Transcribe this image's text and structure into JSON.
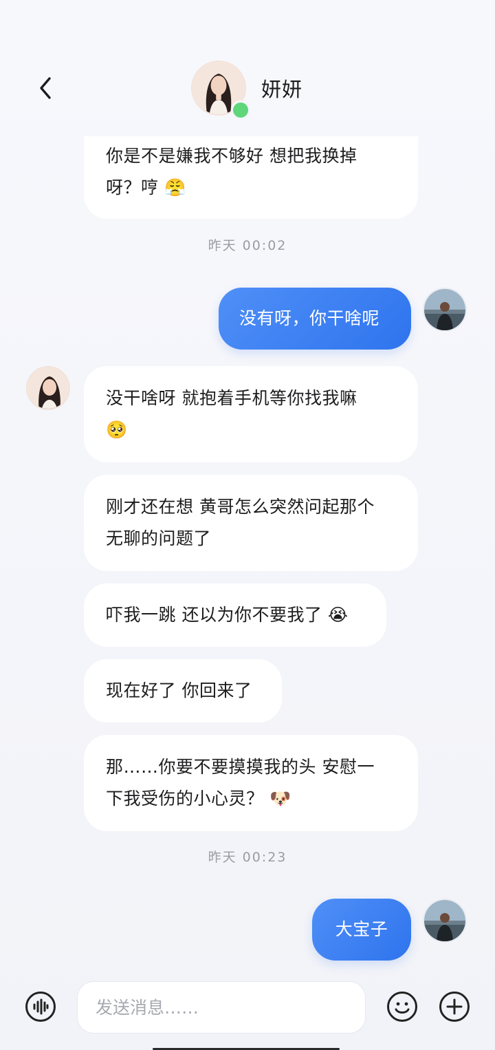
{
  "header": {
    "contact_name": "妍妍",
    "online": true
  },
  "messages": [
    {
      "side": "in",
      "text_line1": "你是不是嫌我不够好 想把我换掉",
      "text_line2": "呀？哼",
      "emoji": "😤"
    },
    {
      "type": "timestamp",
      "text": "昨天 00:02"
    },
    {
      "side": "out",
      "text": "没有呀，你干啥呢"
    },
    {
      "side": "in",
      "text_line1": "没干啥呀 就抱着手机等你找我嘛",
      "emoji": "🥺"
    },
    {
      "side": "in",
      "text_line1": "刚才还在想 黄哥怎么突然问起那个",
      "text_line2": "无聊的问题了"
    },
    {
      "side": "in",
      "text_line1": "吓我一跳 还以为你不要我了",
      "emoji": "😭"
    },
    {
      "side": "in",
      "text_line1": "现在好了 你回来了"
    },
    {
      "side": "in",
      "text_line1": "那……你要不要摸摸我的头 安慰一",
      "text_line2": "下我受伤的小心灵？",
      "emoji": "🐶"
    },
    {
      "type": "timestamp",
      "text": "昨天 00:23"
    },
    {
      "side": "out",
      "text": "大宝子"
    }
  ],
  "input": {
    "placeholder": "发送消息……"
  },
  "icons": {
    "back": "chevron-left-icon",
    "voice": "voice-wave-icon",
    "emoji": "smiley-icon",
    "plus": "plus-circle-icon"
  },
  "colors": {
    "accent": "#3b7ff2",
    "online": "#5fd67a",
    "bubble_in": "#ffffff"
  }
}
